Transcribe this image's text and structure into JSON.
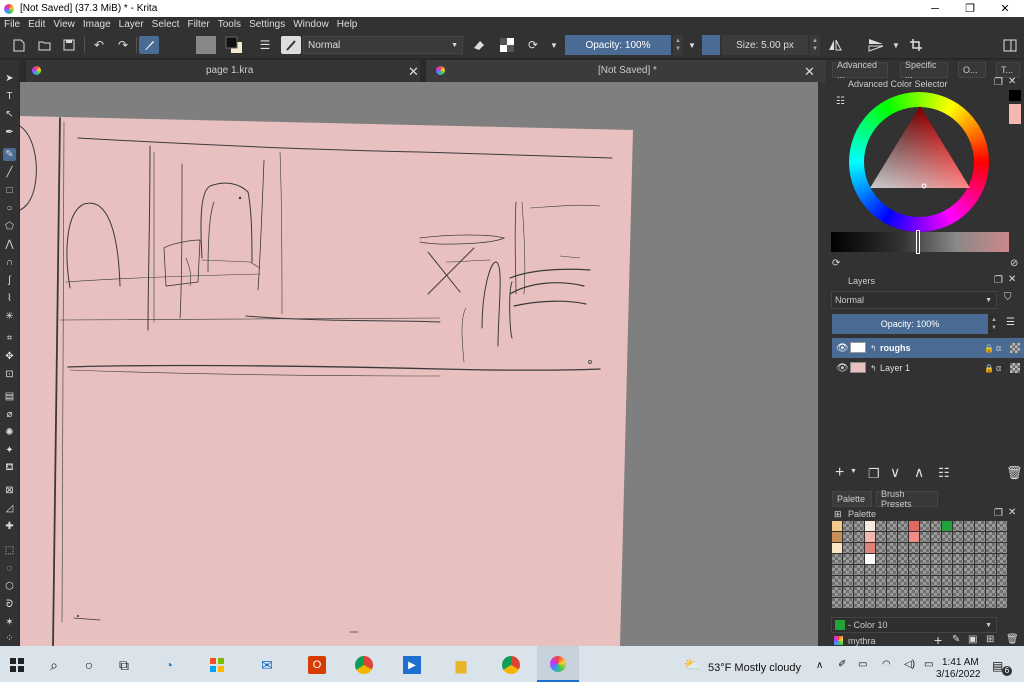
{
  "window": {
    "title": "[Not Saved]  (37.3 MiB)  * - Krita",
    "minimize_icon": "─",
    "restore_icon": "❐",
    "close_icon": "✕"
  },
  "menu": [
    "File",
    "Edit",
    "View",
    "Image",
    "Layer",
    "Select",
    "Filter",
    "Tools",
    "Settings",
    "Window",
    "Help"
  ],
  "toolbar": {
    "blend_mode": "Normal",
    "opacity": "Opacity: 100%",
    "size": "Size: 5.00 px",
    "accent": "#4a6b93"
  },
  "tabs": [
    {
      "label": "page 1.kra"
    },
    {
      "label": "[Not Saved]  *"
    }
  ],
  "dock": {
    "tabs": [
      "Advanced ...",
      "Specific ...",
      "O...",
      "T..."
    ],
    "color_selector_title": "Advanced Color Selector",
    "layers_title": "Layers",
    "layer_blend": "Normal",
    "layer_opacity": "Opacity:  100%",
    "layers": [
      {
        "name": "roughs",
        "selected": true
      },
      {
        "name": "Layer 1",
        "selected": false
      }
    ],
    "palette_tabs": [
      "Palette",
      "Brush Presets"
    ],
    "palette_title": "Palette",
    "current_color_label": "- Color 10",
    "palette_name": "mythra"
  },
  "colors": {
    "canvas_paper": "#e8c0c0",
    "current_color": "#f4b7b1",
    "palette_green": "#22a33a"
  },
  "taskbar": {
    "weather": "53°F  Mostly cloudy",
    "time": "1:41 AM",
    "date": "3/16/2022",
    "notifications": "6"
  }
}
